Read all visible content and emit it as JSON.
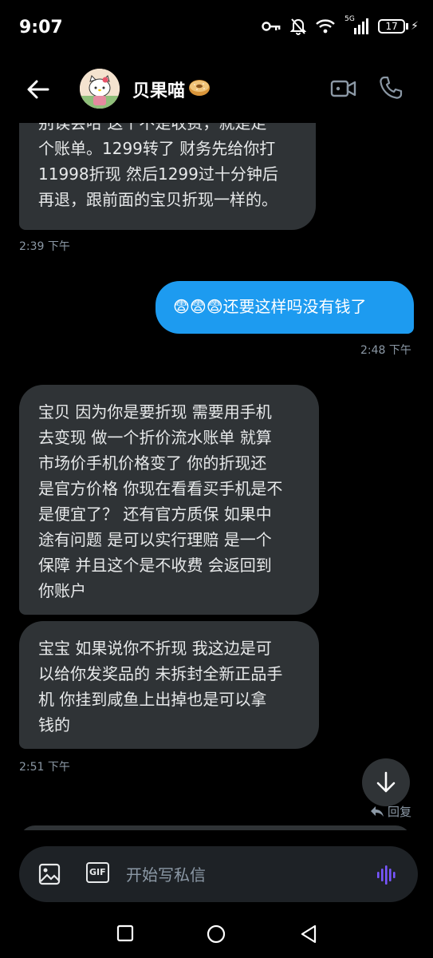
{
  "status_bar": {
    "time": "9:07",
    "network": "5G",
    "battery": "17"
  },
  "header": {
    "title": "贝果喵",
    "title_emoji": "🥯",
    "back_icon": "arrow-left-icon",
    "video_icon": "video-camera-icon",
    "call_icon": "phone-icon"
  },
  "messages": [
    {
      "direction": "incoming",
      "lines": [
        "别误会哈 这个不是收费，就是走",
        "个账单。1299转了 财务先给你打",
        "11998折现  然后1299过十分钟后",
        "再退，跟前面的宝贝折现一样的。"
      ]
    },
    {
      "direction": "outgoing",
      "text": "😨😨😨还要这样吗没有钱了"
    },
    {
      "direction": "incoming",
      "lines": [
        "宝贝  因为你是要折现  需要用手机",
        "去变现  做一个折价流水账单 就算",
        "市场价手机价格变了  你的折现还",
        "是官方价格 你现在看看买手机是不",
        "是便宜了？ 还有官方质保   如果中",
        "途有问题 是可以实行理赔  是一个",
        "保障  并且这个是不收费 会返回到",
        "你账户"
      ]
    },
    {
      "direction": "incoming",
      "lines": [
        "宝宝  如果说你不折现 我这边是可",
        "以给你发奖品的 未拆封全新正品手",
        "机  你挂到咸鱼上出掉也是可以拿",
        "钱的"
      ]
    }
  ],
  "timestamps": {
    "t1": "2:39 下午",
    "t2": "2:48 下午",
    "t3": "2:51 下午"
  },
  "reply_label": "回复",
  "composer": {
    "placeholder": "开始写私信",
    "image_icon": "image-icon",
    "gif_label": "GIF",
    "voice_icon": "voice-wave-icon"
  },
  "colors": {
    "incoming_bubble": "#2f3336",
    "outgoing_bubble": "#1d9bf0",
    "accent_voice": "#7856ff"
  }
}
